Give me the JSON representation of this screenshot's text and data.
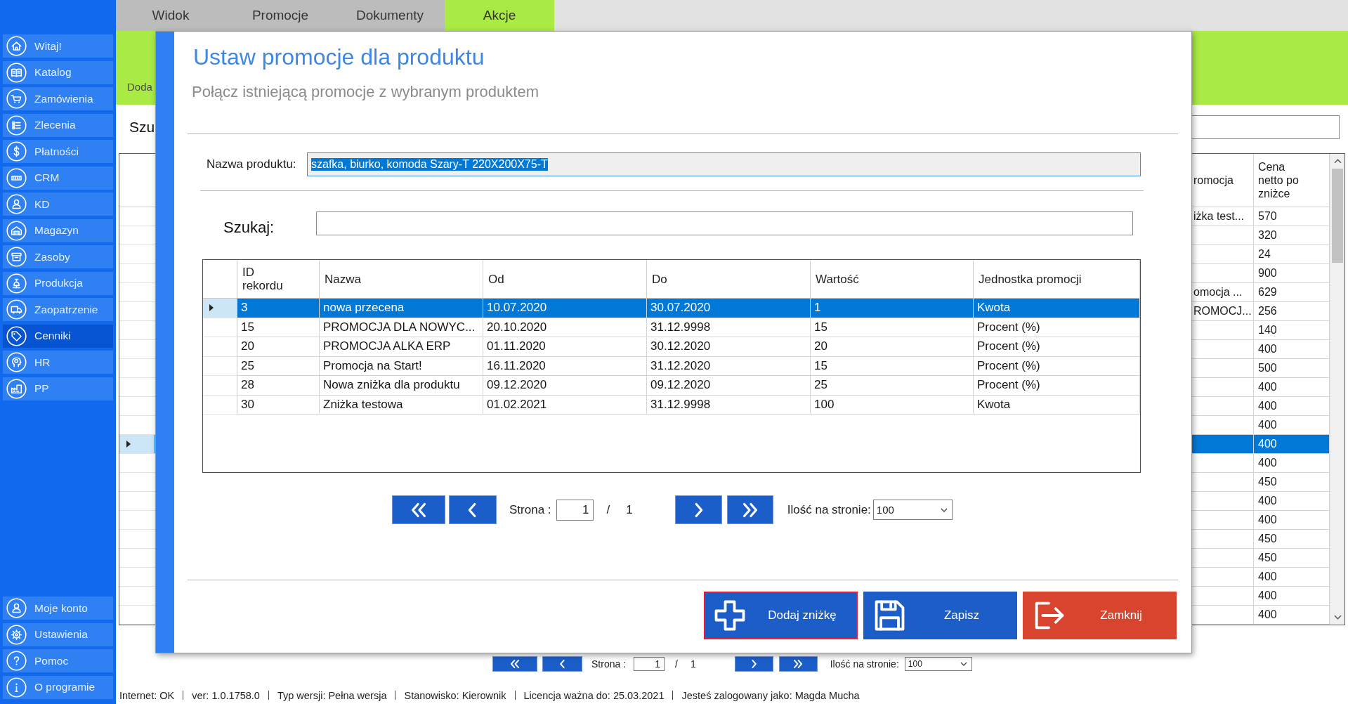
{
  "sidebar": {
    "items": [
      {
        "label": "Witaj!",
        "selected": false
      },
      {
        "label": "Katalog",
        "selected": false
      },
      {
        "label": "Zamówienia",
        "selected": false
      },
      {
        "label": "Zlecenia",
        "selected": false
      },
      {
        "label": "Płatności",
        "selected": false
      },
      {
        "label": "CRM",
        "selected": false
      },
      {
        "label": "KD",
        "selected": false
      },
      {
        "label": "Magazyn",
        "selected": false
      },
      {
        "label": "Zasoby",
        "selected": false
      },
      {
        "label": "Produkcja",
        "selected": false
      },
      {
        "label": "Zaopatrzenie",
        "selected": false
      },
      {
        "label": "Cenniki",
        "selected": true
      },
      {
        "label": "HR",
        "selected": false
      },
      {
        "label": "PP",
        "selected": false
      }
    ],
    "bottom_items": [
      {
        "label": "Moje konto",
        "selected": false
      },
      {
        "label": "Ustawienia",
        "selected": false
      },
      {
        "label": "Pomoc",
        "selected": false
      },
      {
        "label": "O programie",
        "selected": false
      }
    ]
  },
  "menu_tabs": [
    {
      "label": "Widok",
      "selected": false
    },
    {
      "label": "Promocje",
      "selected": false
    },
    {
      "label": "Dokumenty",
      "selected": false
    },
    {
      "label": "Akcje",
      "selected": true
    }
  ],
  "ribbon": {
    "label": "Doda"
  },
  "search": {
    "label": "Szu"
  },
  "table": {
    "columns": [
      "romocja",
      "Cena netto po zniżce"
    ],
    "rows": [
      {
        "selected": false,
        "promocja": "iżka test...",
        "cena_netto": "570"
      },
      {
        "selected": false,
        "cena_netto": "320"
      },
      {
        "selected": false,
        "cena_netto": "24"
      },
      {
        "selected": false,
        "cena_netto": "900"
      },
      {
        "selected": false,
        "promocja": "omocja ...",
        "cena_netto": "629"
      },
      {
        "selected": false,
        "promocja": "ROMOCJ...",
        "cena_netto": "256"
      },
      {
        "selected": false,
        "cena_netto": "140"
      },
      {
        "selected": false,
        "cena_netto": "400"
      },
      {
        "selected": false,
        "cena_netto": "500"
      },
      {
        "selected": false,
        "cena_netto": "400"
      },
      {
        "selected": false,
        "cena_netto": "400"
      },
      {
        "selected": false,
        "cena_netto": "400"
      },
      {
        "selected": true,
        "cena_netto": "400"
      },
      {
        "selected": false,
        "cena_netto": "400"
      },
      {
        "selected": false,
        "cena_netto": "450"
      },
      {
        "selected": false,
        "cena_netto": "400"
      },
      {
        "selected": false,
        "cena_netto": "400"
      },
      {
        "selected": false,
        "cena_netto": "450"
      },
      {
        "selected": false,
        "cena_netto": "450"
      },
      {
        "selected": false,
        "cena_netto": "400"
      },
      {
        "selected": false,
        "cena_netto": "400"
      },
      {
        "selected": false,
        "cena_netto": "400"
      }
    ]
  },
  "pagination": {
    "page_label": "Strona :",
    "page": "1",
    "separator": "/",
    "total_pages": "1",
    "page_size_label": "Ilość na stronie:",
    "page_size": "100"
  },
  "status_bar": [
    "Internet: OK",
    "ver: 1.0.1758.0",
    "Typ wersji: Pełna wersja",
    "Stanowisko: Kierownik",
    "Licencja ważna do: 25.03.2021",
    "Jesteś zalogowany jako: Magda Mucha"
  ],
  "dialog": {
    "title": "Ustaw promocje dla produktu",
    "subtitle": "Połącz istniejącą promocje z wybranym produktem",
    "product_name": {
      "label": "Nazwa produktu:",
      "value": "szafka, biurko, komoda Szary-T 220X200X75-T",
      "highlighted": true
    },
    "search": {
      "label": "Szukaj:"
    },
    "table": {
      "columns": [
        "ID rekordu",
        "Nazwa",
        "Od",
        "Do",
        "Wartość",
        "Jednostka promocji"
      ],
      "rows": [
        {
          "selected": true,
          "cells": [
            "3",
            "nowa przecena",
            "10.07.2020",
            "30.07.2020",
            "1",
            "Kwota"
          ]
        },
        {
          "selected": false,
          "cells": [
            "15",
            "PROMOCJA DLA NOWYC...",
            "20.10.2020",
            "31.12.9998",
            "15",
            "Procent (%)"
          ]
        },
        {
          "selected": false,
          "cells": [
            "20",
            "PROMOCJA ALKA ERP",
            "01.11.2020",
            "30.12.2020",
            "20",
            "Procent (%)"
          ]
        },
        {
          "selected": false,
          "cells": [
            "25",
            "Promocja na Start!",
            "16.11.2020",
            "31.12.2020",
            "15",
            "Procent (%)"
          ]
        },
        {
          "selected": false,
          "cells": [
            "28",
            "Nowa zniżka dla produktu",
            "09.12.2020",
            "09.12.2020",
            "25",
            "Procent (%)"
          ]
        },
        {
          "selected": false,
          "cells": [
            "30",
            "Zniżka testowa",
            "01.02.2021",
            "31.12.9998",
            "100",
            "Kwota"
          ]
        }
      ]
    },
    "pagination": {
      "page_label": "Strona :",
      "page": "1",
      "separator": "/",
      "total_pages": "1",
      "page_size_label": "Ilość na stronie:",
      "page_size": "100"
    },
    "buttons": [
      {
        "label": "Dodaj zniżkę",
        "kind": "add",
        "focused": true
      },
      {
        "label": "Zapisz",
        "kind": "save",
        "focused": false
      },
      {
        "label": "Zamknij",
        "kind": "close",
        "focused": false
      }
    ]
  }
}
